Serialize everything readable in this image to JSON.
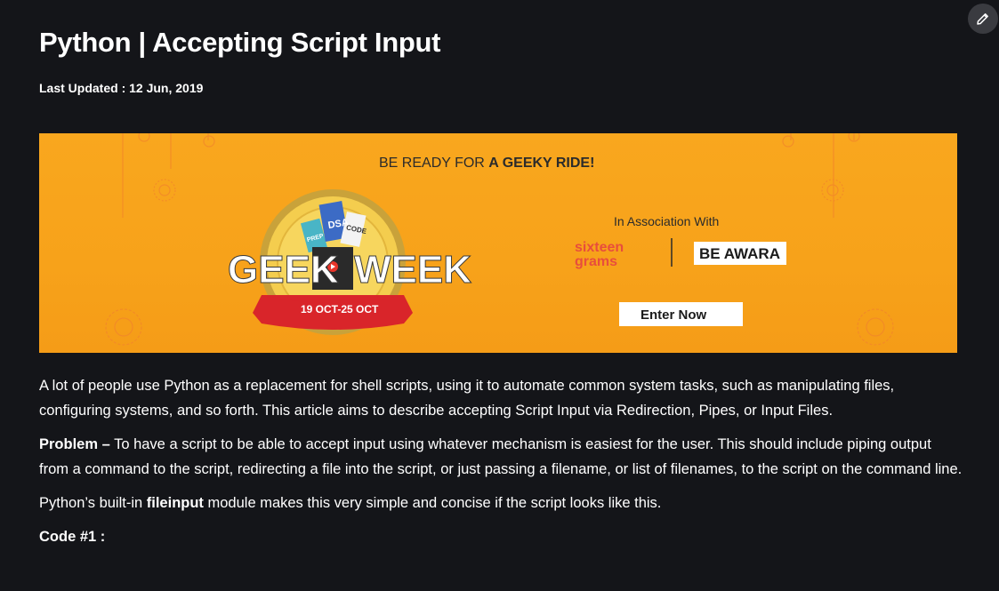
{
  "article": {
    "title": "Python | Accepting Script Input",
    "last_updated": "Last Updated : 12 Jun, 2019",
    "intro": "A lot of people use Python as a replacement for shell scripts, using it to automate common system tasks, such as manipulating files, configuring systems, and so forth. This article aims to describe accepting Script Input via Redirection, Pipes, or Input Files.",
    "problem_label": "Problem –",
    "problem_text": " To have a script to be able to accept input using whatever mechanism is easiest for the user. This should include piping output from a command to the script, redirecting a file into the script, or just passing a filename, or list of filenames, to the script on the command line.",
    "fileinput_prefix": "Python’s built-in ",
    "fileinput_keyword": "fileinput",
    "fileinput_suffix": " module makes this very simple and concise if the script looks like this.",
    "code_heading": "Code #1 :"
  },
  "banner": {
    "tagline_prefix": "BE READY FOR ",
    "tagline_bold": "A GEEKY RIDE!",
    "logo_left": "GEEK",
    "logo_right": "WEEK",
    "ribbon": "19 OCT-25 OCT",
    "tag1": "DSA",
    "tag2": "CODE",
    "tag3": "PREP",
    "association": "In Association With",
    "sponsor1_line1": "sixteen",
    "sponsor1_line2": "grams",
    "sponsor2": "BE AWARA",
    "cta": "Enter Now"
  },
  "icons": {
    "edit": "pencil-icon"
  },
  "colors": {
    "page_bg": "#141519",
    "banner_bg": "#f7a21a",
    "ribbon_red": "#d9252a",
    "medal_gold": "#c9a23a",
    "sponsor_red": "#e84e3c"
  }
}
